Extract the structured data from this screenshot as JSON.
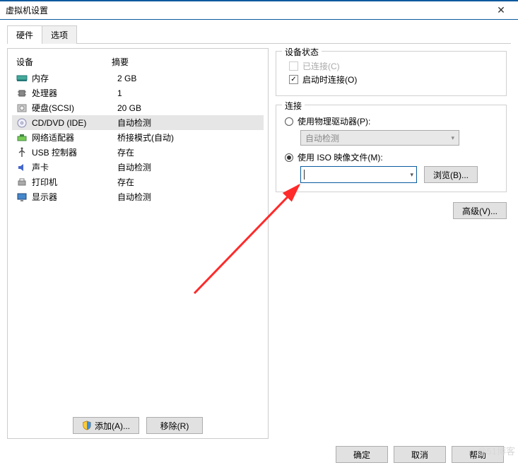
{
  "window": {
    "title": "虚拟机设置",
    "close": "✕"
  },
  "tabs": {
    "hardware": "硬件",
    "options": "选项"
  },
  "list": {
    "header_device": "设备",
    "header_summary": "摘要",
    "rows": [
      {
        "device": "内存",
        "summary": "2 GB",
        "icon": "memory"
      },
      {
        "device": "处理器",
        "summary": "1",
        "icon": "cpu"
      },
      {
        "device": "硬盘(SCSI)",
        "summary": "20 GB",
        "icon": "hdd"
      },
      {
        "device": "CD/DVD (IDE)",
        "summary": "自动检测",
        "icon": "cd",
        "selected": true
      },
      {
        "device": "网络适配器",
        "summary": "桥接模式(自动)",
        "icon": "net"
      },
      {
        "device": "USB 控制器",
        "summary": "存在",
        "icon": "usb"
      },
      {
        "device": "声卡",
        "summary": "自动检测",
        "icon": "sound"
      },
      {
        "device": "打印机",
        "summary": "存在",
        "icon": "printer"
      },
      {
        "device": "显示器",
        "summary": "自动检测",
        "icon": "display"
      }
    ],
    "add_button": "添加(A)...",
    "remove_button": "移除(R)"
  },
  "status_group": {
    "title": "设备状态",
    "connected": "已连接(C)",
    "connect_at_power_on": "启动时连接(O)"
  },
  "connection_group": {
    "title": "连接",
    "use_physical": "使用物理驱动器(P):",
    "physical_combo": "自动检测",
    "use_iso": "使用 ISO 映像文件(M):",
    "iso_path": "",
    "browse": "浏览(B)...",
    "advanced": "高级(V)..."
  },
  "dialog_buttons": {
    "ok": "确定",
    "cancel": "取消",
    "help": "帮助"
  },
  "watermark": "@51博客"
}
